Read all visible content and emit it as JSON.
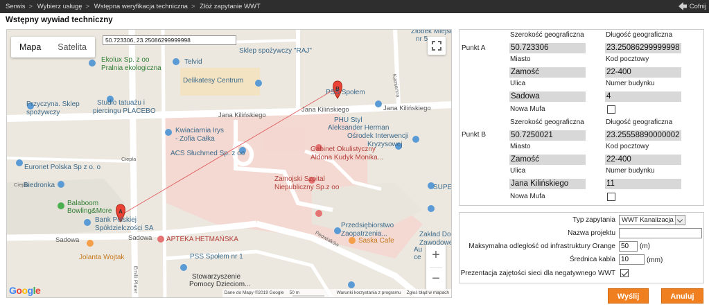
{
  "breadcrumb": [
    "Serwis",
    "Wybierz usługę",
    "Wstępna weryfikacja techniczna",
    "Złóż zapytanie WWT"
  ],
  "breadcrumb_separator": ">",
  "back_label": "Cofnij",
  "page_title": "Wstępny wywiad techniczny",
  "map": {
    "type_buttons": [
      "Mapa",
      "Satelita"
    ],
    "coord_input": "50.723306, 23.25086299999998",
    "marker_a": "A",
    "marker_b": "B",
    "labels": {
      "zlobek": "Żłobek Miejski",
      "zlobek2": "nr 5",
      "raj": "Sklep spożywczy \"RAJ\"",
      "ekolux": "Ekolux Sp. z oo",
      "ekolux2": "Pralnia ekologiczna",
      "telvid": "Telvid",
      "delikatesy": "Delikatesy Centrum",
      "studio": "Studio tatuażu i",
      "studio2": "piercingu PLACEBO",
      "przyczyna": "Przyczyna. Sklep",
      "przyczyna2": "spożywczy",
      "pss": "PSS Społem",
      "kamienna": "Kamienna",
      "kilinskiego1": "Jana Kilińskiego",
      "kilinskiego2": "Jana Kilińskiego",
      "kilinskiego3": "Jana Kilińskiego",
      "phu": "PHU Styl",
      "phu2": "Aleksander Herman",
      "osrodek": "Ośrodek Interwencji",
      "osrodek2": "Kryzysowej",
      "kwiaciarnia": "Kwiaciarnia Irys",
      "kwiaciarnia2": "- Zofia Całka",
      "acs": "ACS Słuchmed Sp. z oo",
      "gabinet": "Gabinet Okulistyczny",
      "gabinet2": "Aldona Kudyk Monika...",
      "ciepla1": "Ciepła",
      "ciepla2": "Ciepła",
      "euronet": "Euronet Polska Sp z o. o",
      "biedronka": "Biedronka",
      "zamojski": "Zamojski Szpital",
      "zamojski2": "Niepubliczny Sp.z oo",
      "super": "SUPER",
      "balaboom": "Balaboom",
      "balaboom2": "Bowling&More",
      "bank": "Bank Polskiej",
      "bank2": "Spółdzielczości SA",
      "przedsiebiorstwo": "Przedsiębiorstwo",
      "przedsiebiorstwo2": "Zaopatrzenia...",
      "zaklad": "Zakład Dos",
      "zaklad2": "Zawodowe",
      "sadowa1": "Sadowa",
      "sadowa2": "Sadowa",
      "apteka": "APTEKA HETMAŃSKA",
      "peowiakow": "Peowiaków",
      "saska": "Saska Cafe",
      "jolanta": "Jolanta Wojtak",
      "pss1": "PSS Społem nr 1",
      "auto": "Au",
      "auto2": "ce",
      "emilii": "Emilii Plater",
      "stowarzyszenie": "Stowarzyszenie",
      "stowarzyszenie2": "Pomocy Dzieciom..."
    },
    "attribution": [
      "Dane do Mapy ©2019 Google",
      "50 m",
      "Warunki korzystania z programu",
      "Zgłoś błąd w mapach"
    ],
    "zoom_in": "+",
    "zoom_out": "−"
  },
  "point_a": {
    "title": "Punkt A",
    "lat_label": "Szerokość geograficzna",
    "lon_label": "Długość geograficzna",
    "lat": "50.723306",
    "lon": "23.25086299999998",
    "city_label": "Miasto",
    "zip_label": "Kod pocztowy",
    "city": "Zamość",
    "zip": "22-400",
    "street_label": "Ulica",
    "number_label": "Numer budynku",
    "street": "Sadowa",
    "number": "4",
    "mufa_label": "Nowa Mufa",
    "mufa_checked": false
  },
  "point_b": {
    "title": "Punkt B",
    "lat_label": "Szerokość geograficzna",
    "lon_label": "Długość geograficzna",
    "lat": "50.7250021",
    "lon": "23.25558890000002",
    "city_label": "Miasto",
    "zip_label": "Kod pocztowy",
    "city": "Zamość",
    "zip": "22-400",
    "street_label": "Ulica",
    "number_label": "Numer budynku",
    "street": "Jana Kilińskiego",
    "number": "11",
    "mufa_label": "Nowa Mufa",
    "mufa_checked": false
  },
  "form": {
    "type_label": "Typ zapytania",
    "type_value": "WWT Kanalizacja",
    "project_label": "Nazwa projektu",
    "project_value": "",
    "distance_label": "Maksymalna odległość od infrastruktury Orange",
    "distance_value": "50",
    "distance_unit": "(m)",
    "diameter_label": "Średnica kabla",
    "diameter_value": "10",
    "diameter_unit": "(mm)",
    "presentation_label": "Prezentacja zajętości sieci dla negatywnego WWT",
    "presentation_checked": true
  },
  "buttons": {
    "send": "Wyślij",
    "cancel": "Anuluj"
  },
  "colors": {
    "accent": "#f07f1f",
    "topbar": "#2e2e2e",
    "field_bg": "#d8d8d8",
    "marker": "#ea4335"
  }
}
